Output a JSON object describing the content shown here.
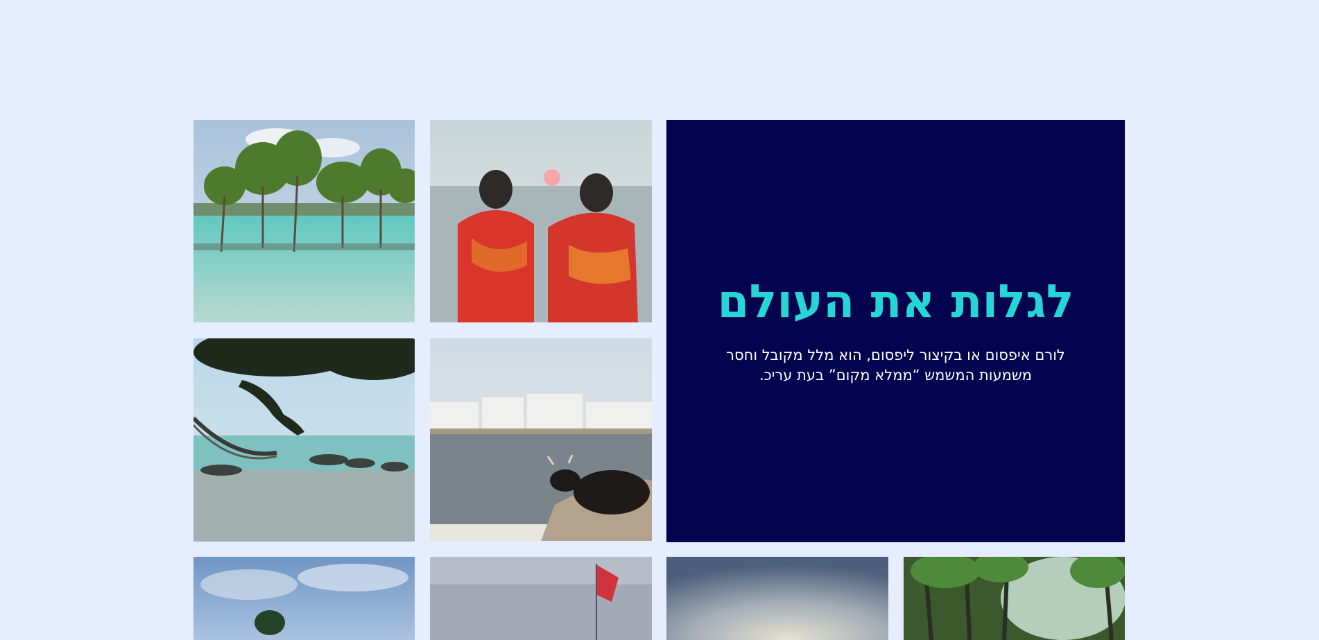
{
  "hero": {
    "title": "לגלות את העולם",
    "text": "לורם איפסום או בקיצור ליפסום, הוא מלל מקובל וחסר משמעות המשמש “ממלא מקום” בעת עריכ."
  },
  "colors": {
    "page_background": "#e5edff",
    "hero_background": "#02024f",
    "title_color": "#26d6d6",
    "text_color": "#ffffff"
  },
  "gallery": [
    {
      "scene": "mangrove trees in turquoise water"
    },
    {
      "scene": "two women in red saris facing sunset over sea"
    },
    {
      "scene": "hammock under tree on beach"
    },
    {
      "scene": "cow resting by lake with white town"
    },
    {
      "scene": "cloudy sky over sea with tree"
    },
    {
      "scene": "sea with red flag"
    },
    {
      "scene": "hazy sunset sky"
    },
    {
      "scene": "palm trees with sunlight"
    }
  ]
}
